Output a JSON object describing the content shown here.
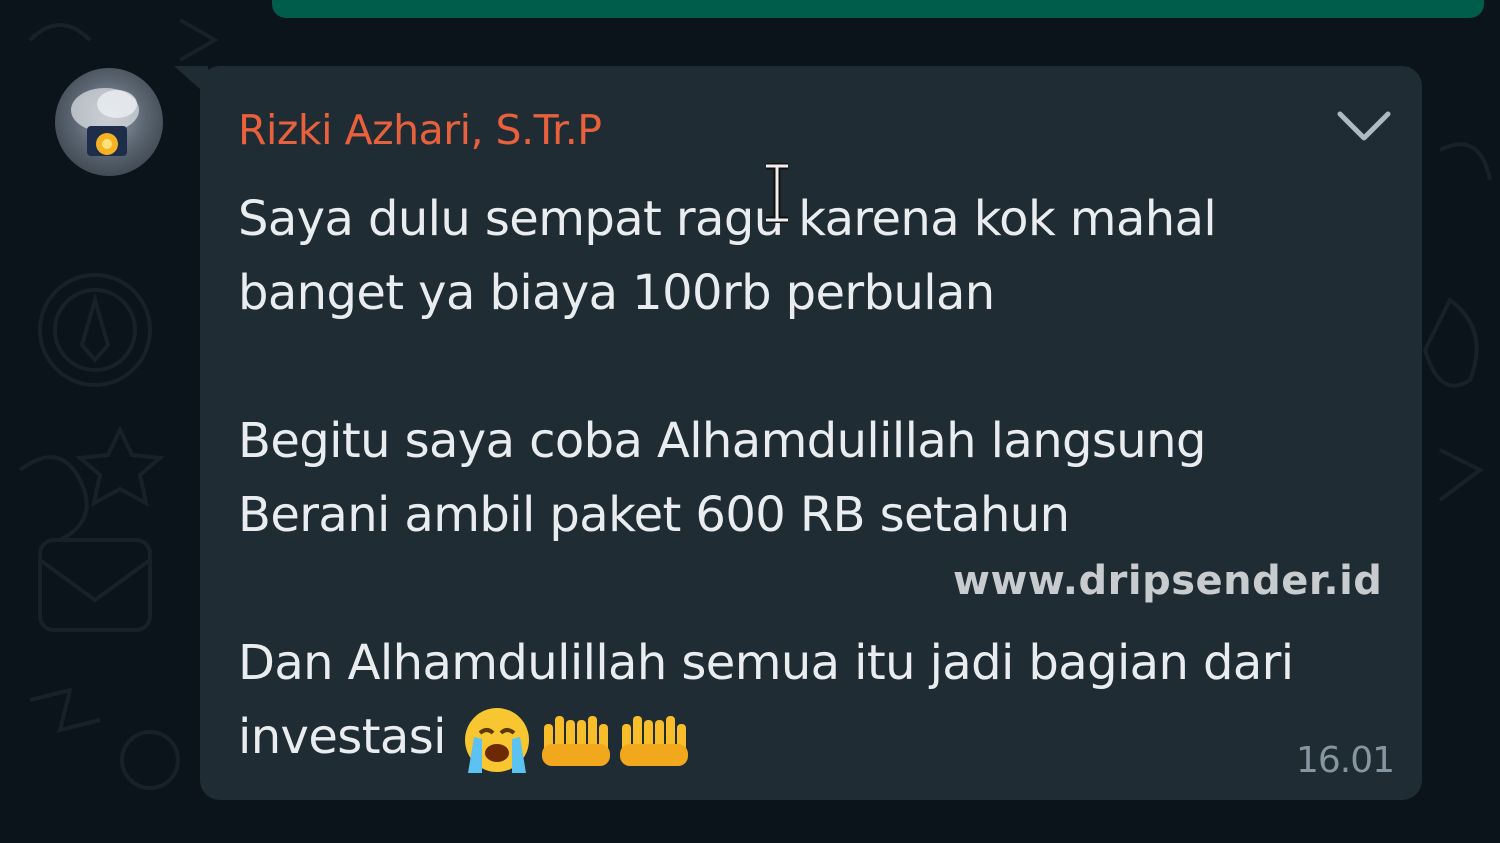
{
  "message": {
    "sender": "Rizki Azhari, S.Tr.P",
    "lines": [
      "Saya dulu sempat ragu karena kok mahal",
      "banget ya biaya 100rb perbulan",
      "",
      "Begitu saya coba Alhamdulillah langsung",
      "Berani ambil paket 600 RB setahun",
      "",
      "Dan Alhamdulillah semua itu jadi bagian dari",
      "investasi"
    ],
    "emojis": [
      "loudly-crying-face",
      "palms-up-together",
      "palms-up-together"
    ],
    "time": "16.01"
  },
  "watermark": "www.dripsender.id",
  "colors": {
    "background": "#0b141a",
    "bubble": "#202c33",
    "outgoing_bubble": "#005c4b",
    "sender_name": "#e9603d",
    "message_text": "#e9edef",
    "timestamp": "#8696a0"
  },
  "icons": {
    "menu": "chevron-down-icon",
    "cursor": "text-cursor-icon"
  }
}
